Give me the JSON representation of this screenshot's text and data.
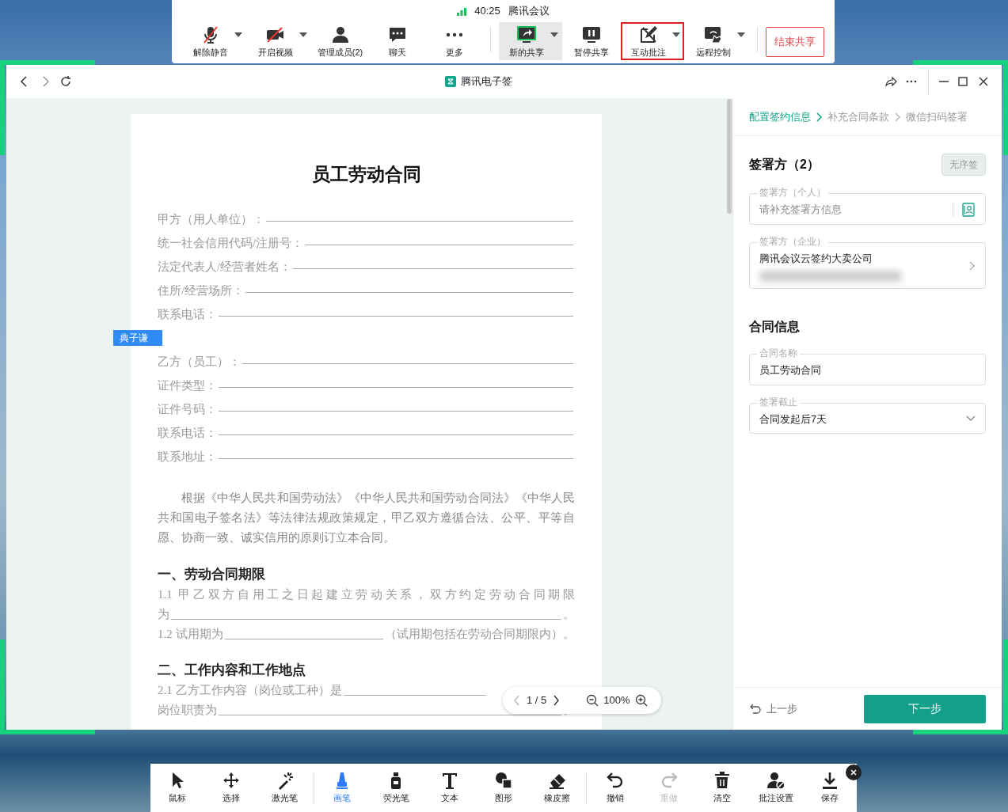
{
  "meeting_bar": {
    "time": "40:25",
    "title": "腾讯会议",
    "groups": [
      {
        "buttons": [
          {
            "kind": "mic",
            "label": "解除静音",
            "dropdown": true,
            "selected": false,
            "highlighted": false
          },
          {
            "kind": "camera",
            "label": "开启视频",
            "dropdown": true,
            "selected": false,
            "highlighted": false
          },
          {
            "kind": "members",
            "label": "管理成员(2)",
            "dropdown": false,
            "selected": false,
            "highlighted": false
          },
          {
            "kind": "chat",
            "label": "聊天",
            "dropdown": false,
            "selected": false,
            "highlighted": false
          },
          {
            "kind": "more",
            "label": "更多",
            "dropdown": false,
            "selected": false,
            "highlighted": false
          }
        ]
      },
      {
        "buttons": [
          {
            "kind": "share",
            "label": "新的共享",
            "dropdown": true,
            "selected": true,
            "highlighted": false
          },
          {
            "kind": "pause",
            "label": "暂停共享",
            "dropdown": false,
            "selected": false,
            "highlighted": false
          },
          {
            "kind": "annotate",
            "label": "互动批注",
            "dropdown": true,
            "selected": false,
            "highlighted": true
          },
          {
            "kind": "remote",
            "label": "远程控制",
            "dropdown": true,
            "selected": false,
            "highlighted": false
          }
        ]
      }
    ],
    "end_button": "结束共享"
  },
  "window": {
    "title": "腾讯电子签"
  },
  "document": {
    "title": "员工劳动合同",
    "party_a": [
      [
        {
          "kind": "text",
          "text": "甲方（用人单位）："
        },
        {
          "kind": "blank"
        }
      ],
      [
        {
          "kind": "text",
          "text": "统一社会信用代码/注册号："
        },
        {
          "kind": "blank"
        }
      ],
      [
        {
          "kind": "text",
          "text": "法定代表人/经营者姓名："
        },
        {
          "kind": "blank"
        }
      ],
      [
        {
          "kind": "text",
          "text": "住所/经营场所："
        },
        {
          "kind": "blank"
        }
      ],
      [
        {
          "kind": "text",
          "text": "联系电话："
        },
        {
          "kind": "blank"
        }
      ]
    ],
    "party_b": [
      [
        {
          "kind": "text",
          "text": "乙方（员工）："
        },
        {
          "kind": "blank"
        }
      ],
      [
        {
          "kind": "text",
          "text": "证件类型："
        },
        {
          "kind": "blank"
        }
      ],
      [
        {
          "kind": "text",
          "text": "证件号码："
        },
        {
          "kind": "blank"
        }
      ],
      [
        {
          "kind": "text",
          "text": "联系电话："
        },
        {
          "kind": "blank"
        }
      ],
      [
        {
          "kind": "text",
          "text": "联系地址："
        },
        {
          "kind": "blank"
        }
      ]
    ],
    "preamble": "根据《中华人民共和国劳动法》《中华人民共和国劳动合同法》《中华人民共和国电子签名法》等法律法规政策规定，甲乙双方遵循合法、公平、平等自愿、协商一致、诚实信用的原则订立本合同。",
    "sections": [
      {
        "heading": "一、劳动合同期限",
        "lines": [
          [
            {
              "kind": "text",
              "text": "1.1 甲乙双方自用工之日起建立劳动关系，双方约定劳动合同期限"
            }
          ],
          [
            {
              "kind": "text",
              "text": "为"
            },
            {
              "kind": "blank"
            },
            {
              "kind": "text",
              "text": "。"
            }
          ],
          [
            {
              "kind": "text",
              "text": "1.2 试用期为"
            },
            {
              "kind": "blank"
            },
            {
              "kind": "text",
              "text": "（试用期包括在劳动合同期限内）。"
            }
          ]
        ]
      },
      {
        "heading": "二、工作内容和工作地点",
        "lines": [
          [
            {
              "kind": "text",
              "text": "2.1 乙方工作内容（岗位或工种）是"
            },
            {
              "kind": "blank"
            }
          ],
          [
            {
              "kind": "text",
              "text": "岗位职责为"
            },
            {
              "kind": "blank"
            },
            {
              "kind": "text",
              "text": "。"
            }
          ]
        ]
      }
    ]
  },
  "annotation_tag": "典子谦",
  "pager": {
    "page": "1 / 5",
    "zoom": "100%"
  },
  "panel": {
    "steps": [
      {
        "label": "配置签约信息",
        "selected": true
      },
      {
        "label": "补充合同条款",
        "selected": false
      },
      {
        "label": "微信扫码签署",
        "selected": false
      }
    ],
    "signers_title": "签署方（2）",
    "order_button": "无序签",
    "signers": [
      {
        "kind": "contact",
        "label": "签署方（个人）",
        "placeholder": "请补充签署方信息",
        "redacted": false
      },
      {
        "kind": "link",
        "label": "签署方（企业）",
        "value": "腾讯会议云签约大卖公司",
        "redacted": true
      }
    ],
    "contract_title": "合同信息",
    "contract_fields": [
      {
        "kind": "text",
        "label": "合同名称",
        "value": "员工劳动合同"
      },
      {
        "kind": "select",
        "label": "签署截止",
        "value": "合同发起后7天"
      }
    ],
    "back": "上一步",
    "next": "下一步"
  },
  "annotation_tools": {
    "groups": [
      {
        "tools": [
          {
            "kind": "pointer",
            "label": "鼠标",
            "selected": false,
            "disabled": false
          },
          {
            "kind": "move",
            "label": "选择",
            "selected": false,
            "disabled": false
          },
          {
            "kind": "laser",
            "label": "激光笔",
            "selected": false,
            "disabled": false
          }
        ]
      },
      {
        "tools": [
          {
            "kind": "pen",
            "label": "画笔",
            "selected": true,
            "disabled": false
          },
          {
            "kind": "highlighter",
            "label": "荧光笔",
            "selected": false,
            "disabled": false
          },
          {
            "kind": "text",
            "label": "文本",
            "selected": false,
            "disabled": false
          },
          {
            "kind": "shape",
            "label": "图形",
            "selected": false,
            "disabled": false
          },
          {
            "kind": "eraser",
            "label": "橡皮擦",
            "selected": false,
            "disabled": false
          }
        ]
      },
      {
        "tools": [
          {
            "kind": "undo",
            "label": "撤销",
            "selected": false,
            "disabled": false
          },
          {
            "kind": "redo",
            "label": "重做",
            "selected": false,
            "disabled": true
          },
          {
            "kind": "clear",
            "label": "清空",
            "selected": false,
            "disabled": false
          },
          {
            "kind": "settings",
            "label": "批注设置",
            "selected": false,
            "disabled": false
          },
          {
            "kind": "save",
            "label": "保存",
            "selected": false,
            "disabled": false
          }
        ]
      }
    ]
  }
}
